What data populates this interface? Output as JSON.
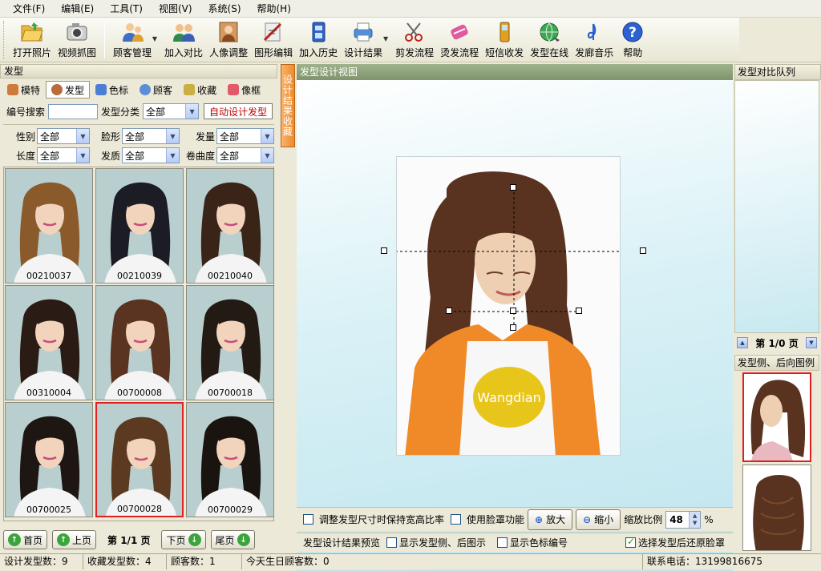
{
  "menu": [
    "文件(F)",
    "编辑(E)",
    "工具(T)",
    "视图(V)",
    "系统(S)",
    "帮助(H)"
  ],
  "toolbar": {
    "items": [
      {
        "label": "打开照片",
        "icon": "folder-open-icon"
      },
      {
        "label": "视频抓图",
        "icon": "camera-icon"
      },
      {
        "label": "顾客管理",
        "icon": "customer-icon"
      },
      {
        "label": "加入对比",
        "icon": "compare-icon"
      },
      {
        "label": "人像调整",
        "icon": "portrait-icon"
      },
      {
        "label": "图形编辑",
        "icon": "graphic-edit-icon"
      },
      {
        "label": "加入历史",
        "icon": "history-icon"
      },
      {
        "label": "设计结果",
        "icon": "printer-icon"
      },
      {
        "label": "剪发流程",
        "icon": "scissors-icon"
      },
      {
        "label": "烫发流程",
        "icon": "perm-icon"
      },
      {
        "label": "短信收发",
        "icon": "phone-icon"
      },
      {
        "label": "发型在线",
        "icon": "globe-icon"
      },
      {
        "label": "发廊音乐",
        "icon": "music-icon"
      },
      {
        "label": "帮助",
        "icon": "help-icon"
      }
    ]
  },
  "left_panel": {
    "title": "发型",
    "tabs": [
      {
        "label": "模特",
        "icon": "model-icon",
        "color": "#d07a3a"
      },
      {
        "label": "发型",
        "icon": "hairstyle-icon",
        "color": "#b86b3c"
      },
      {
        "label": "色标",
        "icon": "palette-icon",
        "color": "#4b7fd6"
      },
      {
        "label": "顾客",
        "icon": "customer-tab-icon",
        "color": "#5a8fd8"
      },
      {
        "label": "收藏",
        "icon": "favorites-icon",
        "color": "#c9b040"
      },
      {
        "label": "像框",
        "icon": "frame-icon",
        "color": "#e05a6a"
      }
    ],
    "search_label": "编号搜索",
    "search_value": "",
    "category_label": "发型分类",
    "category_value": "全部",
    "auto_button": "自动设计发型",
    "filters": [
      {
        "label": "性别",
        "value": "全部"
      },
      {
        "label": "脸形",
        "value": "全部"
      },
      {
        "label": "发量",
        "value": "全部"
      },
      {
        "label": "长度",
        "value": "全部"
      },
      {
        "label": "发质",
        "value": "全部"
      },
      {
        "label": "卷曲度",
        "value": "全部"
      }
    ],
    "thumbnails": [
      {
        "code": "00210037",
        "hair": "#8b5a2b"
      },
      {
        "code": "00210039",
        "hair": "#1c1c24"
      },
      {
        "code": "00210040",
        "hair": "#3a2418"
      },
      {
        "code": "00310004",
        "hair": "#2a1c14"
      },
      {
        "code": "00700008",
        "hair": "#5a3420"
      },
      {
        "code": "00700018",
        "hair": "#241a14"
      },
      {
        "code": "00700025",
        "hair": "#1e1612"
      },
      {
        "code": "00700028",
        "hair": "#5c3a22"
      },
      {
        "code": "00700029",
        "hair": "#1a1410"
      }
    ],
    "pager": {
      "first": "首页",
      "prev": "上页",
      "page_text": "第 1/1 页",
      "next": "下页",
      "last": "尾页"
    }
  },
  "center": {
    "vertical_tab": "设计结果收藏",
    "title": "发型设计视图",
    "photo_shirt_text": "Wangdian",
    "keep_ratio_label": "调整发型尺寸时保持宽高比率",
    "face_mask_label": "使用脸罩功能",
    "zoom_in": "放大",
    "zoom_out": "缩小",
    "zoom_ratio_label": "缩放比例",
    "zoom_value": "48",
    "zoom_unit": "%",
    "preview_label": "发型设计结果预览",
    "show_side_label": "显示发型侧、后图示",
    "show_color_label": "显示色标编号",
    "restore_mask_label": "选择发型后还原脸罩"
  },
  "right_panel": {
    "queue_title": "发型对比队列",
    "page_text": "第 1/0 页",
    "side_title": "发型侧、后向图例"
  },
  "status": {
    "designs": "设计发型数：9",
    "favorites": "收藏发型数：4",
    "customers": "顾客数：1",
    "birthday": "今天生日顾客数：0",
    "phone": "联系电话：13199816675"
  }
}
